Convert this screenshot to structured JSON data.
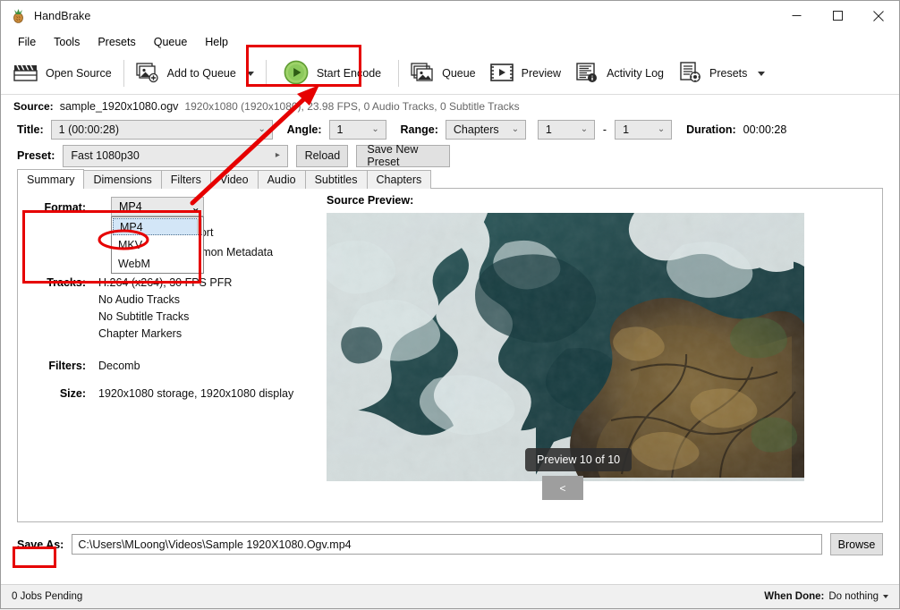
{
  "window": {
    "title": "HandBrake",
    "app_icon": "handbrake-pineapple-icon",
    "controls": {
      "minimize": "minimize-icon",
      "maximize": "maximize-icon",
      "close": "close-icon"
    }
  },
  "menubar": {
    "items": [
      "File",
      "Tools",
      "Presets",
      "Queue",
      "Help"
    ]
  },
  "toolbar": {
    "open_source": "Open Source",
    "add_to_queue": "Add to Queue",
    "start_encode": "Start Encode",
    "queue": "Queue",
    "preview": "Preview",
    "activity_log": "Activity Log",
    "presets": "Presets"
  },
  "source": {
    "label": "Source:",
    "filename": "sample_1920x1080.ogv",
    "meta": "1920x1080 (1920x1080), 23.98 FPS, 0 Audio Tracks, 0 Subtitle Tracks"
  },
  "title_row": {
    "title_label": "Title:",
    "title_value": "1  (00:00:28)",
    "angle_label": "Angle:",
    "angle_value": "1",
    "range_label": "Range:",
    "range_value": "Chapters",
    "range_start": "1",
    "range_dash": "-",
    "range_end": "1",
    "duration_label": "Duration:",
    "duration_value": "00:00:28"
  },
  "preset_row": {
    "label": "Preset:",
    "value": "Fast 1080p30",
    "reload": "Reload",
    "save_new_preset": "Save New Preset"
  },
  "tabs": [
    {
      "label": "Summary",
      "active": true
    },
    {
      "label": "Dimensions",
      "active": false
    },
    {
      "label": "Filters",
      "active": false
    },
    {
      "label": "Video",
      "active": false
    },
    {
      "label": "Audio",
      "active": false
    },
    {
      "label": "Subtitles",
      "active": false
    },
    {
      "label": "Chapters",
      "active": false
    }
  ],
  "summary": {
    "format_label": "Format:",
    "format_value": "MP4",
    "format_options": [
      "MP4",
      "MKV",
      "WebM"
    ],
    "format_selected": "MP4",
    "ipod_label": "iPod 5G Support",
    "ipod_checked": false,
    "passthru_label": "Passthru Common Metadata",
    "passthru_checked": true,
    "tracks_label": "Tracks:",
    "tracks": [
      "H.264 (x264), 30 FPS PFR",
      "No Audio Tracks",
      "No Subtitle Tracks",
      "Chapter Markers"
    ],
    "filters_label": "Filters:",
    "filters_value": "Decomb",
    "size_label": "Size:",
    "size_value": "1920x1080 storage, 1920x1080 display"
  },
  "preview": {
    "title": "Source Preview:",
    "badge": "Preview 10 of 10",
    "prev_button": "<"
  },
  "save_as": {
    "label": "Save As:",
    "path": "C:\\Users\\MLoong\\Videos\\Sample 1920X1080.Ogv.mp4",
    "browse": "Browse"
  },
  "status": {
    "jobs": "0 Jobs Pending",
    "when_done_label": "When Done:",
    "when_done_value": "Do nothing"
  },
  "annotations": {
    "accent_color": "#e60000",
    "highlight_start_encode": true,
    "highlight_format": true,
    "highlight_save_as": true,
    "circle_mp4_option": true,
    "arrow_to_start_encode": true
  }
}
